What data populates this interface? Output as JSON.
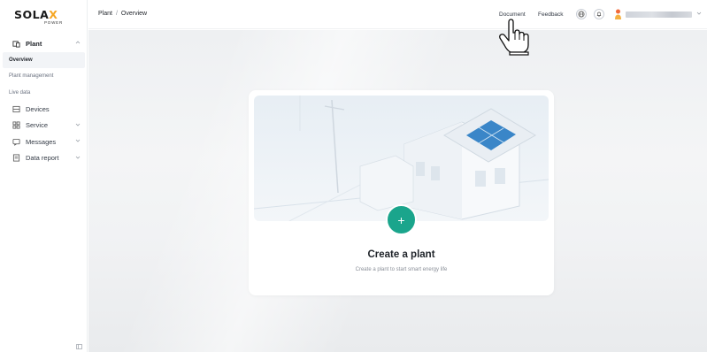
{
  "brand": {
    "name_part1": "SOLA",
    "name_part2": "X",
    "sub": "POWER",
    "accent": "#f5a623"
  },
  "sidebar": {
    "items": [
      {
        "label": "Plant",
        "icon": "plant-icon",
        "expanded": true
      },
      {
        "label": "Overview",
        "active": true
      },
      {
        "label": "Plant management"
      },
      {
        "label": "Live data"
      },
      {
        "label": "Devices",
        "icon": "devices-icon"
      },
      {
        "label": "Service",
        "icon": "service-icon"
      },
      {
        "label": "Messages",
        "icon": "messages-icon"
      },
      {
        "label": "Data report",
        "icon": "report-icon"
      }
    ]
  },
  "header": {
    "breadcrumb": [
      "Plant",
      "Overview"
    ],
    "separator": "/",
    "links": {
      "document": "Document",
      "feedback": "Feedback"
    },
    "icons": [
      "globe-icon",
      "bell-icon"
    ]
  },
  "main": {
    "create_title": "Create a plant",
    "create_subtitle": "Create a plant to start smart energy life",
    "add_label": "+",
    "accent": "#1aa58c"
  }
}
